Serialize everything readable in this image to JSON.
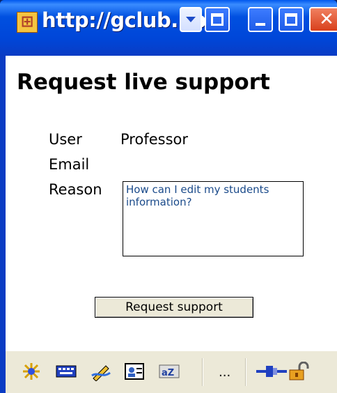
{
  "window": {
    "title": "http://gclub.ub.",
    "icons": {
      "app": "app-icon",
      "dropdown": "chevron-down-icon",
      "restore": "restore-icon",
      "minimize": "minimize-icon",
      "maximize": "maximize-icon",
      "close": "close-icon"
    }
  },
  "page": {
    "heading": "Request live support",
    "fields": {
      "user_label": "User",
      "user_value": "Professor",
      "email_label": "Email",
      "email_value": "",
      "reason_label": "Reason",
      "reason_value": "How can I edit my students information?"
    },
    "submit_label": "Request support"
  },
  "statusbar": {
    "icons": [
      "sparkle-icon",
      "keyboard-icon",
      "pencil-icon",
      "contact-card-icon",
      "az-icon",
      "plug-icon",
      "padlock-icon"
    ],
    "ellipsis": "..."
  },
  "colors": {
    "titlebar": "#0046d8",
    "textarea_text": "#1a4a8a",
    "button_face": "#ece9d8"
  }
}
